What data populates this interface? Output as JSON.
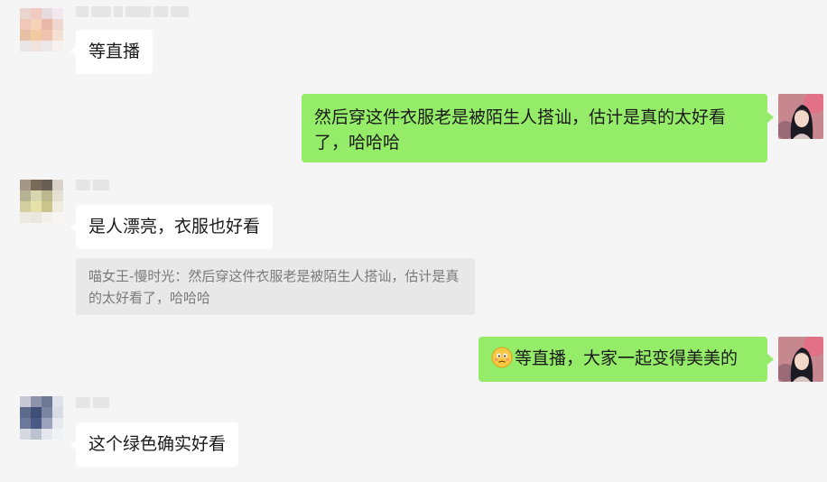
{
  "messages": [
    {
      "id": "m1",
      "direction": "incoming",
      "text": "等直播",
      "avatar_palette": [
        "#e9d6cf",
        "#f1c9c0",
        "#e7dbe2",
        "#f3e8ee",
        "#f0c8b9",
        "#f6d3b8",
        "#e9b8a8",
        "#f0d6cf",
        "#e6c0a4",
        "#f2c9a1",
        "#efc3b0",
        "#f5dfd2",
        "#eae5e6",
        "#f1e3dc",
        "#ece7e8",
        "#f6f0ee"
      ]
    },
    {
      "id": "m2",
      "direction": "outgoing",
      "text": "然后穿这件衣服老是被陌生人搭讪，估计是真的太好看了，哈哈哈"
    },
    {
      "id": "m3",
      "direction": "incoming",
      "text": "是人漂亮，衣服也好看",
      "avatar_palette": [
        "#a49788",
        "#7a6a5a",
        "#6b5e55",
        "#d8d2c9",
        "#b5b394",
        "#d8d6ae",
        "#bdb98e",
        "#e4e0d2",
        "#d2cfa0",
        "#e6e1a8",
        "#cac58c",
        "#f0ece0",
        "#ebe9e2",
        "#e8e6de",
        "#f2f0ea",
        "#f7f6f2"
      ],
      "quote": "喵女王-慢时光：然后穿这件衣服老是被陌生人搭讪，估计是真的太好看了，哈哈哈"
    },
    {
      "id": "m4",
      "direction": "outgoing",
      "text": "等直播，大家一起变得美美的",
      "emoji": "awkward-smile-emoji"
    },
    {
      "id": "m5",
      "direction": "incoming",
      "text": "这个绿色确实好看",
      "avatar_palette": [
        "#c7cad4",
        "#8c93ab",
        "#6d7796",
        "#dfe2ea",
        "#5d6a8c",
        "#3f4f78",
        "#7b86a4",
        "#d7dbe5",
        "#6c789a",
        "#4a5a86",
        "#9aa3bb",
        "#e7e9ef",
        "#d6d9e1",
        "#bcc2d0",
        "#e5e7ec",
        "#f1f2f5"
      ]
    }
  ],
  "colors": {
    "background": "#f5f5f5",
    "incoming_bubble": "#ffffff",
    "outgoing_bubble": "#95ec69",
    "quote_background": "#e8e8e8",
    "quote_text": "#7a7a7a"
  }
}
